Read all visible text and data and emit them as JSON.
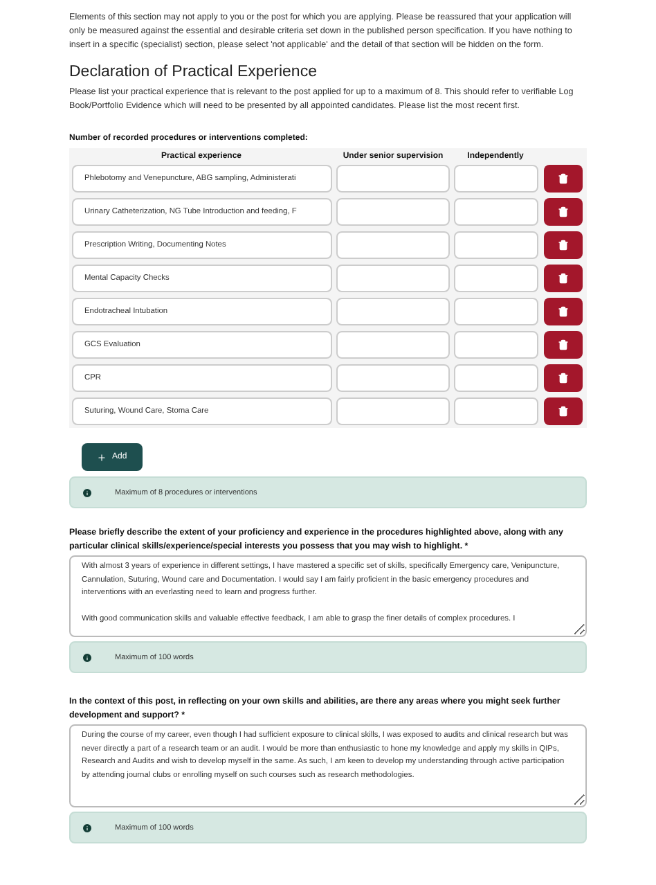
{
  "intro": "Elements of this section may not apply to you or the post for which you are applying. Please be reassured that your application will only be measured against the essential and desirable criteria set down in the published person specification. If you have nothing to insert in a specific (specialist) section, please select 'not applicable' and the detail of that section will be hidden on the form.",
  "heading": "Declaration of Practical Experience",
  "description": "Please list your practical experience that is relevant to the post applied for up to a maximum of 8. This should refer to verifiable Log Book/Portfolio Evidence which will need to be presented by all appointed candidates. Please list the most recent first.",
  "table": {
    "label": "Number of recorded procedures or interventions completed:",
    "columns": [
      "Practical experience",
      "Under senior supervision",
      "Independently"
    ],
    "rows": [
      {
        "experience": "Phlebotomy and Venepuncture, ABG sampling, Administerati"
      },
      {
        "experience": "Urinary Catheterization, NG Tube Introduction and feeding, F"
      },
      {
        "experience": "Prescription Writing, Documenting Notes"
      },
      {
        "experience": "Mental Capacity Checks"
      },
      {
        "experience": "Endotracheal Intubation"
      },
      {
        "experience": "GCS Evaluation"
      },
      {
        "experience": "CPR"
      },
      {
        "experience": "Suturing, Wound Care, Stoma Care"
      }
    ]
  },
  "add_button": "Add",
  "table_note": "Maximum of 8 procedures or interventions",
  "questions": [
    {
      "label": "Please briefly describe the extent of your proficiency and experience in the procedures highlighted above, along with any particular clinical skills/experience/special interests you possess that you may wish to highlight. *",
      "answer": "With almost 3 years of experience in different settings, I have mastered a specific set of skills, specifically Emergency care, Venipuncture, Cannulation, Suturing, Wound care and Documentation. I would say I am fairly proficient in the basic emergency procedures and interventions with an everlasting need to learn and progress further.\n\nWith good communication skills and valuable effective feedback, I am able to grasp the finer details of complex procedures. I",
      "note": "Maximum of 100 words"
    },
    {
      "label": "In the context of this post, in reflecting on your own skills and abilities, are there any areas where you might seek further development and support? *",
      "answer": "During the course of my career, even though I had sufficient exposure to clinical skills, I was exposed to audits and clinical research but was never directly a part of a research team or an audit. I would be more than enthusiastic to hone my knowledge and apply my skills in QIPs, Research and Audits and wish to develop myself in the same. As such, I am keen to develop my understanding through active participation by attending journal clubs or enrolling myself on such courses such as research methodologies.",
      "note": "Maximum of 100 words"
    }
  ]
}
